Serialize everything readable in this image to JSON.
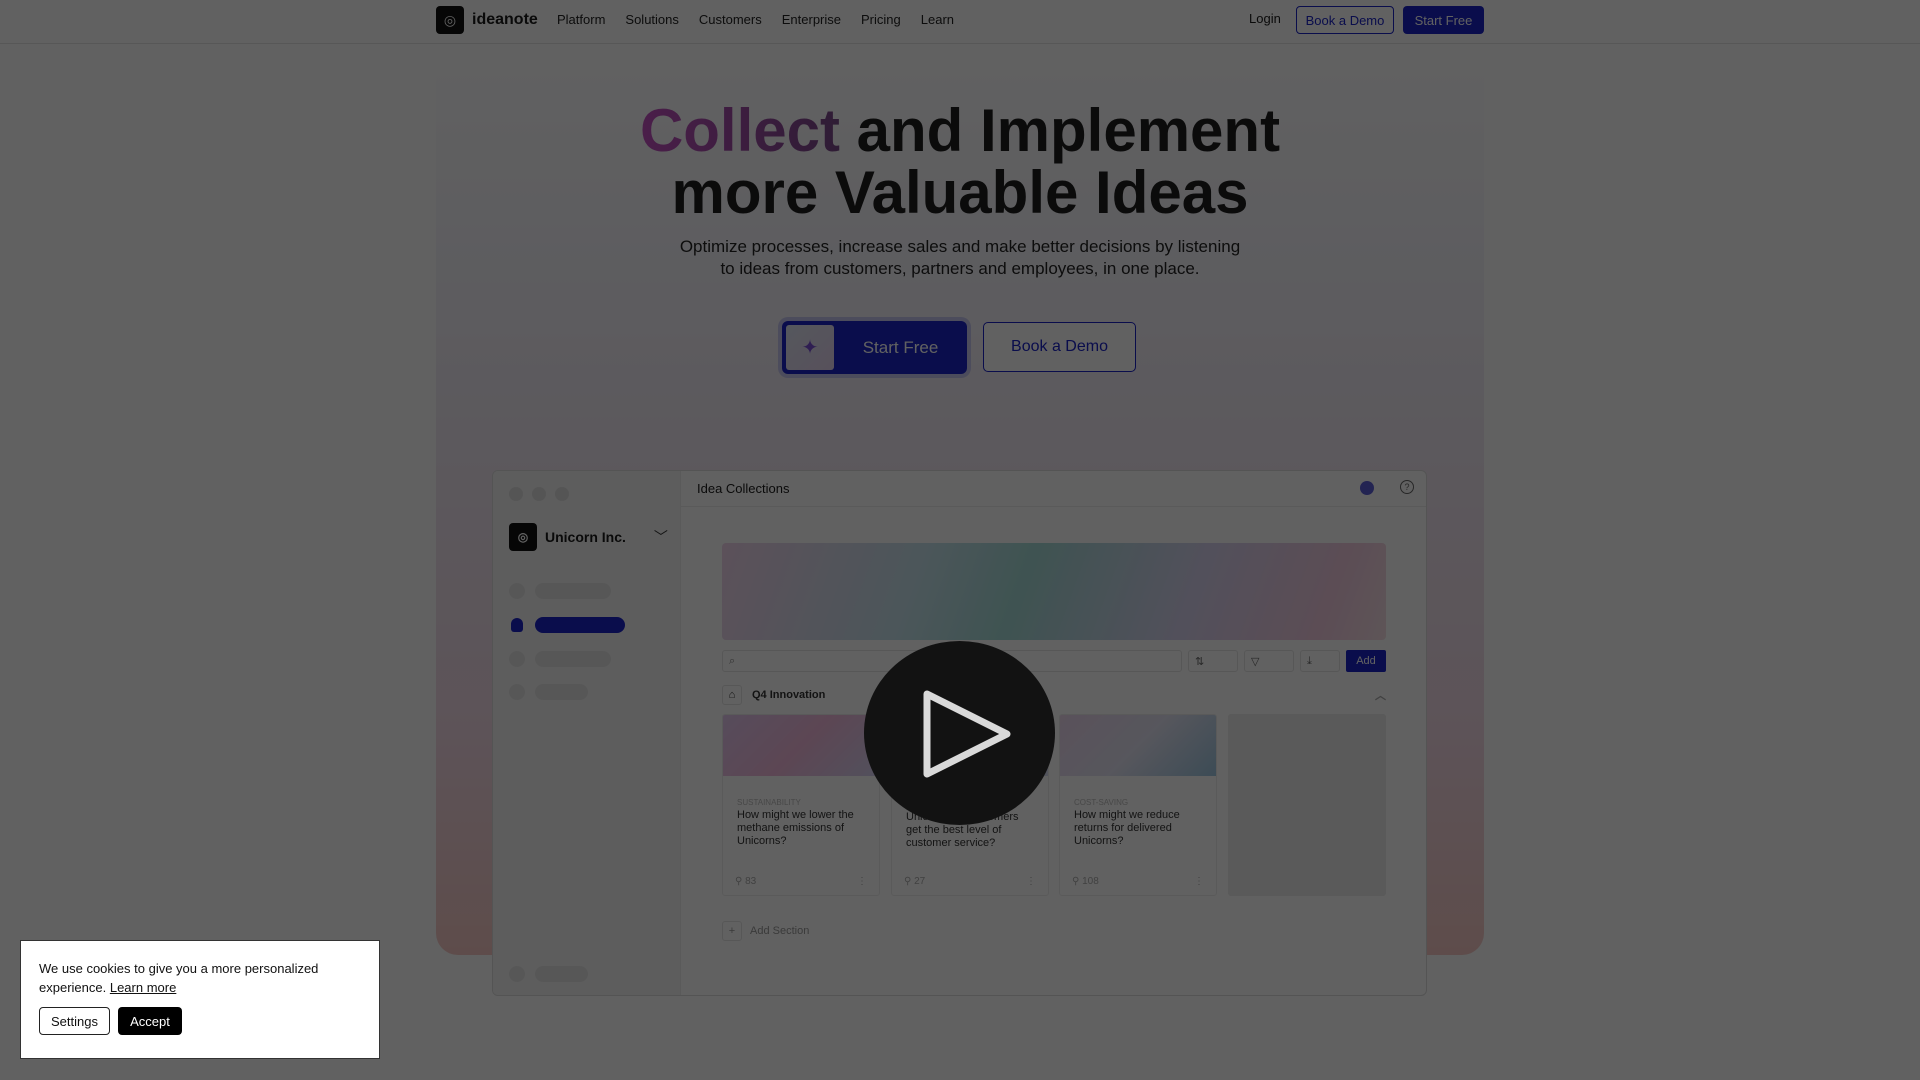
{
  "nav": {
    "brand": "ideanote",
    "items": [
      "Platform",
      "Solutions",
      "Customers",
      "Enterprise",
      "Pricing",
      "Learn"
    ],
    "login": "Login",
    "book_demo": "Book a Demo",
    "start_free": "Start Free"
  },
  "hero": {
    "title_accent": "Collect",
    "title_rest": " and Implement",
    "title_line2": "more Valuable Ideas",
    "subtitle_line1": "Optimize processes, increase sales and make better decisions by listening",
    "subtitle_line2": "to ideas from customers, partners and employees, in one place.",
    "start_free": "Start Free",
    "book_demo": "Book a Demo"
  },
  "app": {
    "org": "Unicorn Inc.",
    "header": "Idea Collections",
    "add": "Add",
    "section": "Q4 Innovation",
    "add_section": "Add Section",
    "cards": [
      {
        "tag": "SUSTAINABILITY",
        "question": "How might we lower the methane emissions of Unicorns?",
        "count": "83"
      },
      {
        "tag": "",
        "question": "How might we ensure Unicorn Inc. customers get the best level of customer service?",
        "count": "27"
      },
      {
        "tag": "COST-SAVING",
        "question": "How might we reduce returns for delivered Unicorns?",
        "count": "108"
      }
    ]
  },
  "video": {
    "icon": "play-icon"
  },
  "cookie": {
    "text": "We use cookies to give you a more personalized experience.",
    "learn_more": "Learn more",
    "settings": "Settings",
    "accept": "Accept"
  },
  "colors": {
    "brand": "#1a23c9",
    "accent": "#c44fc2"
  }
}
